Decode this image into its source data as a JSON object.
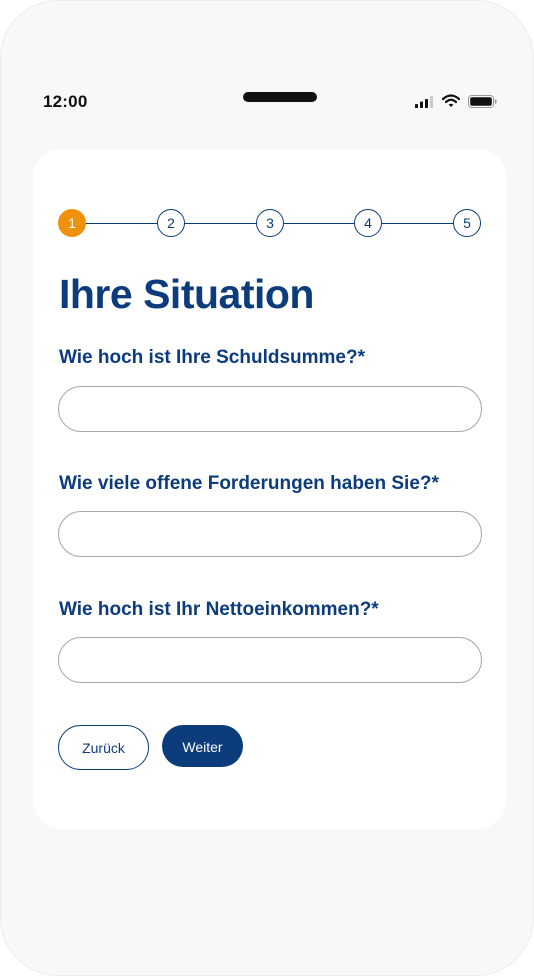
{
  "status_bar": {
    "time": "12:00",
    "icons": [
      "signal-icon",
      "wifi-icon",
      "battery-icon"
    ]
  },
  "stepper": {
    "steps": [
      "1",
      "2",
      "3",
      "4",
      "5"
    ],
    "active_step": 1
  },
  "form": {
    "title": "Ihre Situation",
    "questions": [
      {
        "label": "Wie hoch ist Ihre Schuldsumme?*",
        "value": "",
        "placeholder": ""
      },
      {
        "label": "Wie viele offene Forderungen haben Sie?*",
        "value": "",
        "placeholder": ""
      },
      {
        "label": "Wie hoch ist Ihr Nettoeinkommen?*",
        "value": "",
        "placeholder": ""
      }
    ],
    "back_label": "Zurück",
    "next_label": "Weiter"
  },
  "colors": {
    "brand_blue": "#0d3c7c",
    "accent_orange": "#f0910e",
    "background": "#f8f8f8",
    "card": "#ffffff",
    "input_border": "#aaaaaa"
  }
}
